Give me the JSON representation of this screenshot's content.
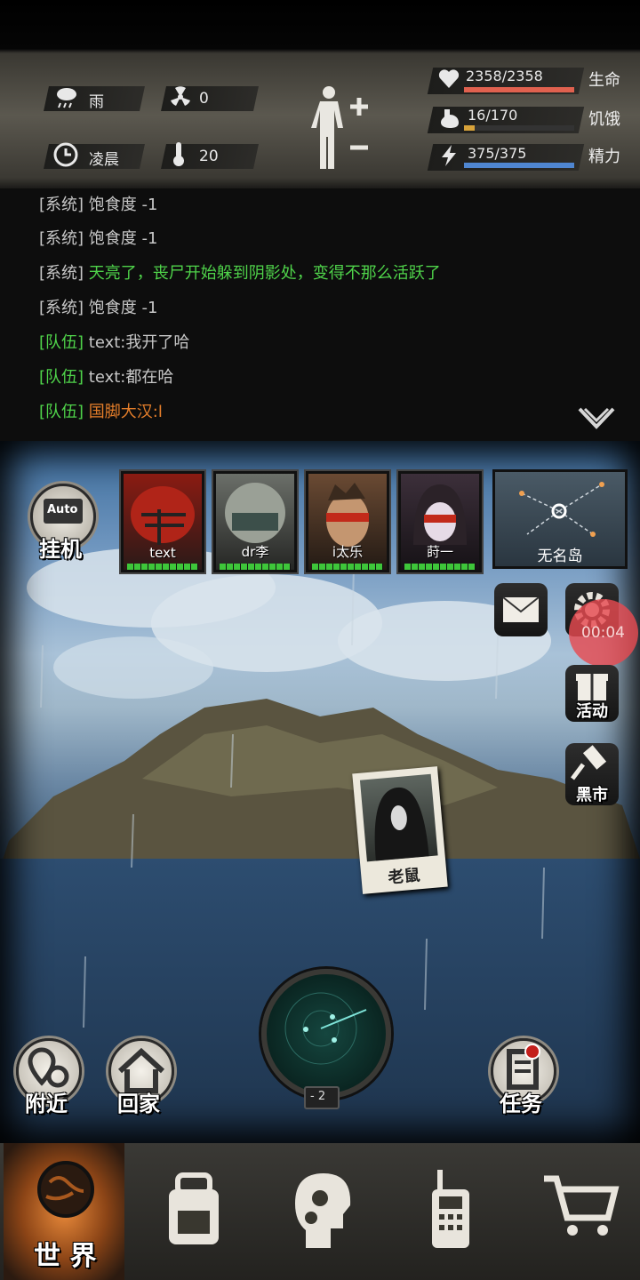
{
  "status": {
    "weather": "雨",
    "radiation": "0",
    "time_of_day": "凌晨",
    "temperature": "20",
    "life": {
      "value": "2358/2358",
      "label": "生命",
      "fraction": 1.0,
      "color": "#e0614f"
    },
    "hunger": {
      "value": "16/170",
      "label": "饥饿",
      "fraction": 0.094,
      "color": "#d8a33a"
    },
    "energy": {
      "value": "375/375",
      "label": "精力",
      "fraction": 1.0,
      "color": "#4f86d1"
    }
  },
  "chat": {
    "messages": [
      {
        "tag": "[系统]",
        "text": "饱食度 -1",
        "style": "sys"
      },
      {
        "tag": "[系统]",
        "text": "饱食度 -1",
        "style": "sys"
      },
      {
        "tag": "[系统]",
        "text": "天亮了，丧尸开始躲到阴影处，变得不那么活跃了",
        "style": "green"
      },
      {
        "tag": "[系统]",
        "text": "饱食度 -1",
        "style": "sys"
      },
      {
        "tag": "[队伍]",
        "text": "text:我开了哈",
        "style": "sys"
      },
      {
        "tag": "[队伍]",
        "text": "text:都在哈",
        "style": "sys"
      },
      {
        "tag": "[队伍]",
        "text": "国脚大汉:l",
        "style": "orange"
      }
    ]
  },
  "scene": {
    "auto_badge": "Auto",
    "idle_label": "挂机",
    "team": [
      "text",
      "dr李",
      "i太乐",
      "莳一"
    ],
    "location": "无名岛",
    "timer": "00:04",
    "event_label": "活动",
    "market_label": "黑市",
    "npc_label": "老鼠",
    "radar_level": "- 2",
    "nearby_label": "附近",
    "home_label": "回家",
    "task_label": "任务"
  },
  "nav": {
    "world_label": "世 界"
  }
}
